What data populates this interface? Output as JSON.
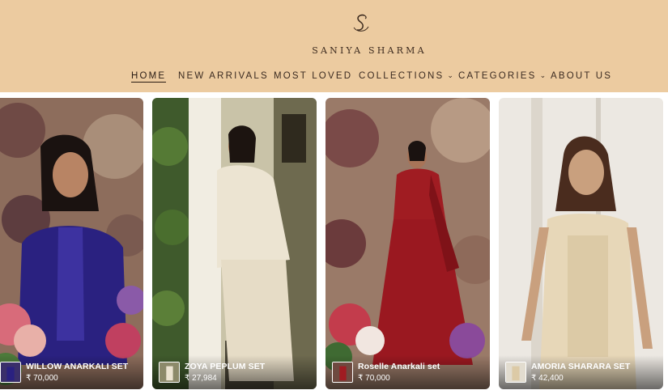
{
  "brand": {
    "name": "SANIYA SHARMA",
    "logo_icon": "swan-s-logo-icon"
  },
  "nav": {
    "items": [
      {
        "label": "HOME",
        "active": true
      },
      {
        "label": "NEW ARRIVALS"
      },
      {
        "label": "MOST LOVED"
      },
      {
        "label": "COLLECTIONS",
        "dropdown": true
      },
      {
        "label": "CATEGORIES",
        "dropdown": true
      },
      {
        "label": "ABOUT US"
      }
    ]
  },
  "products": [
    {
      "name": "WILLOW ANARKALI SET",
      "price": "₹ 70,000"
    },
    {
      "name": "ZOYA PEPLUM SET",
      "price": "₹ 27,984"
    },
    {
      "name": "Roselle Anarkali set",
      "price": "₹ 70,000"
    },
    {
      "name": "AMORIA SHARARA SET",
      "price": "₹ 42,400"
    }
  ],
  "colors": {
    "header_bg": "#eccba0",
    "text_dark": "#3a2a20",
    "indigo_outfit": "#2a2180",
    "ivory_outfit": "#ece4d2",
    "red_outfit": "#a01c22",
    "champagne_outfit": "#e7d7b8"
  }
}
